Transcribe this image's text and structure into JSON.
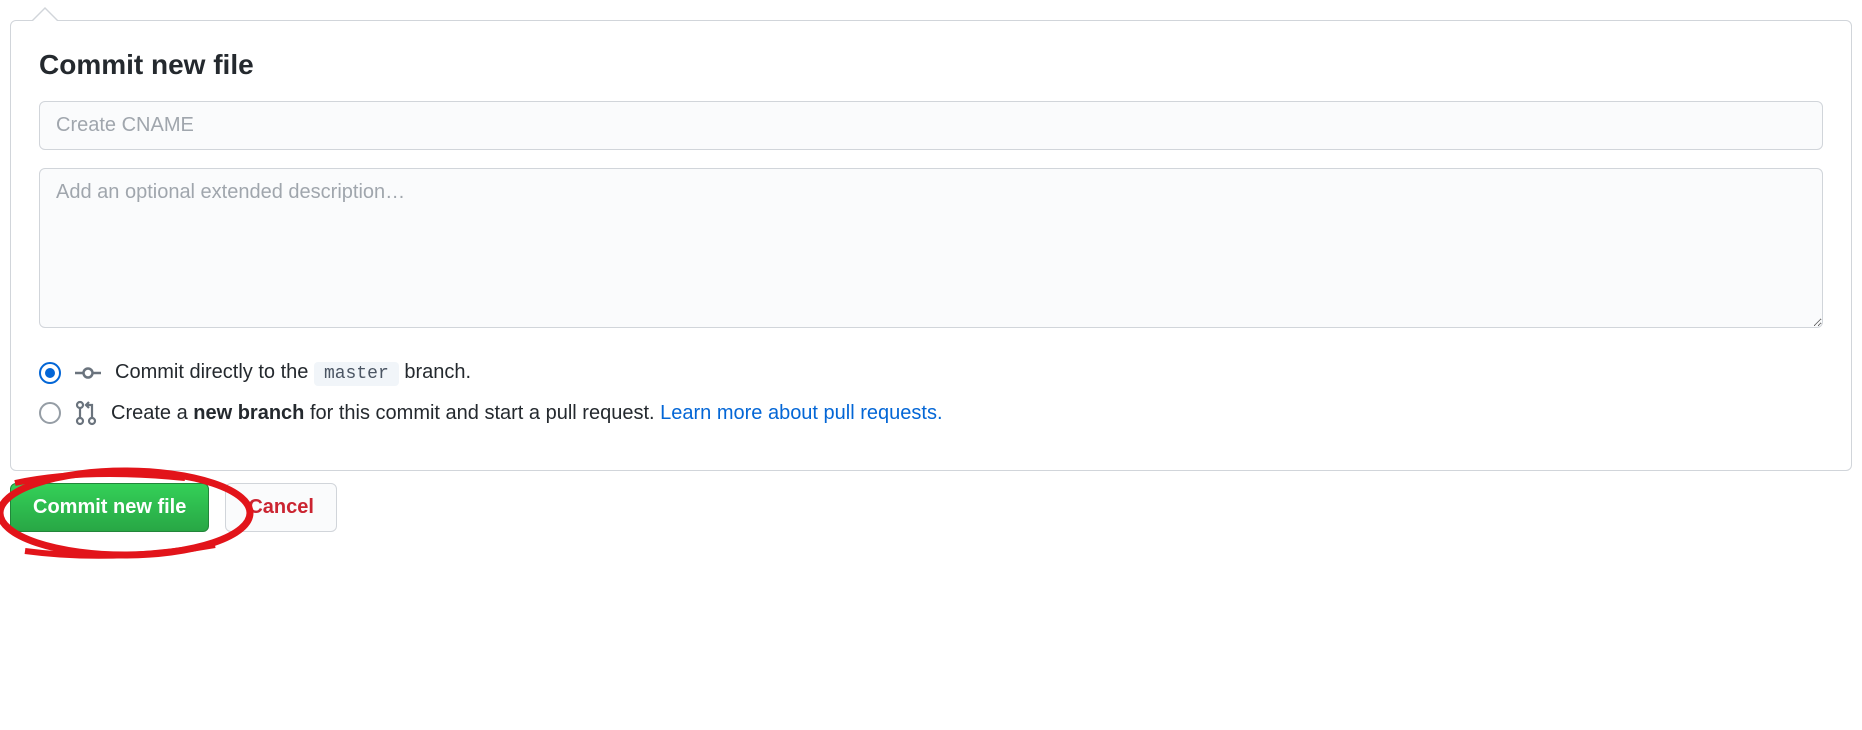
{
  "title": "Commit new file",
  "summary": {
    "placeholder": "Create CNAME",
    "value": ""
  },
  "description": {
    "placeholder": "Add an optional extended description…",
    "value": ""
  },
  "options": {
    "direct": {
      "prefix": "Commit directly to the ",
      "branch": "master",
      "suffix": " branch."
    },
    "newbranch": {
      "prefix": "Create a ",
      "bold": "new branch",
      "mid": " for this commit and start a pull request. ",
      "link": "Learn more about pull requests."
    }
  },
  "buttons": {
    "commit": "Commit new file",
    "cancel": "Cancel"
  }
}
